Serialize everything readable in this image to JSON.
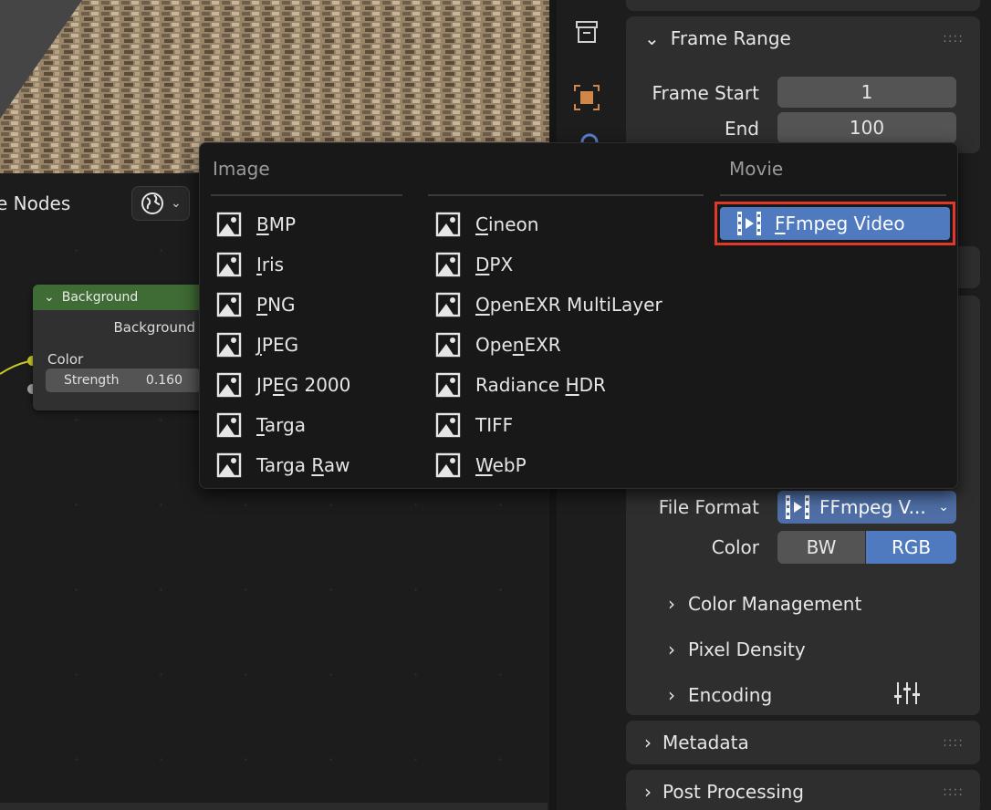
{
  "node_editor": {
    "title_partial": "e Nodes",
    "node": {
      "header": "Background",
      "output": "Background",
      "input_color": "Color",
      "strength_label": "Strength",
      "strength_value": "0.160"
    }
  },
  "properties": {
    "frame_range": {
      "title": "Frame Range",
      "frame_start_label": "Frame Start",
      "frame_start_value": "1",
      "end_label": "End",
      "end_value": "100"
    },
    "output": {
      "file_format_label": "File Format",
      "file_format_value": "FFmpeg V...",
      "color_label": "Color",
      "color_options": [
        "BW",
        "RGB"
      ],
      "color_selected": "RGB",
      "subpanels": [
        "Color Management",
        "Pixel Density",
        "Encoding"
      ]
    },
    "metadata_title": "Metadata",
    "post_processing_title": "Post Processing"
  },
  "popup": {
    "image_title": "Image",
    "movie_title": "Movie",
    "image_col1": [
      {
        "u": "B",
        "rest": "MP"
      },
      {
        "u": "I",
        "rest": "ris"
      },
      {
        "u": "P",
        "rest": "NG"
      },
      {
        "u": "J",
        "rest": "PEG"
      },
      {
        "pre": "JP",
        "u": "E",
        "rest": "G 2000"
      },
      {
        "u": "T",
        "rest": "arga"
      },
      {
        "pre": "Targa ",
        "u": "R",
        "rest": "aw"
      }
    ],
    "image_col2": [
      {
        "u": "C",
        "rest": "ineon"
      },
      {
        "u": "D",
        "rest": "PX"
      },
      {
        "u": "O",
        "rest": "penEXR MultiLayer"
      },
      {
        "pre": "Ope",
        "u": "n",
        "rest": "EXR"
      },
      {
        "pre": "Radiance ",
        "u": "H",
        "rest": "DR"
      },
      {
        "pre": "",
        "u": "",
        "rest": "TIFF"
      },
      {
        "u": "W",
        "rest": "ebP"
      }
    ],
    "movie_item": {
      "u": "F",
      "rest": "Fmpeg Video"
    }
  },
  "colors": {
    "accent_blue": "#4f7ac0",
    "node_header_green": "#3f6b34",
    "highlight_red": "#e0382b"
  }
}
